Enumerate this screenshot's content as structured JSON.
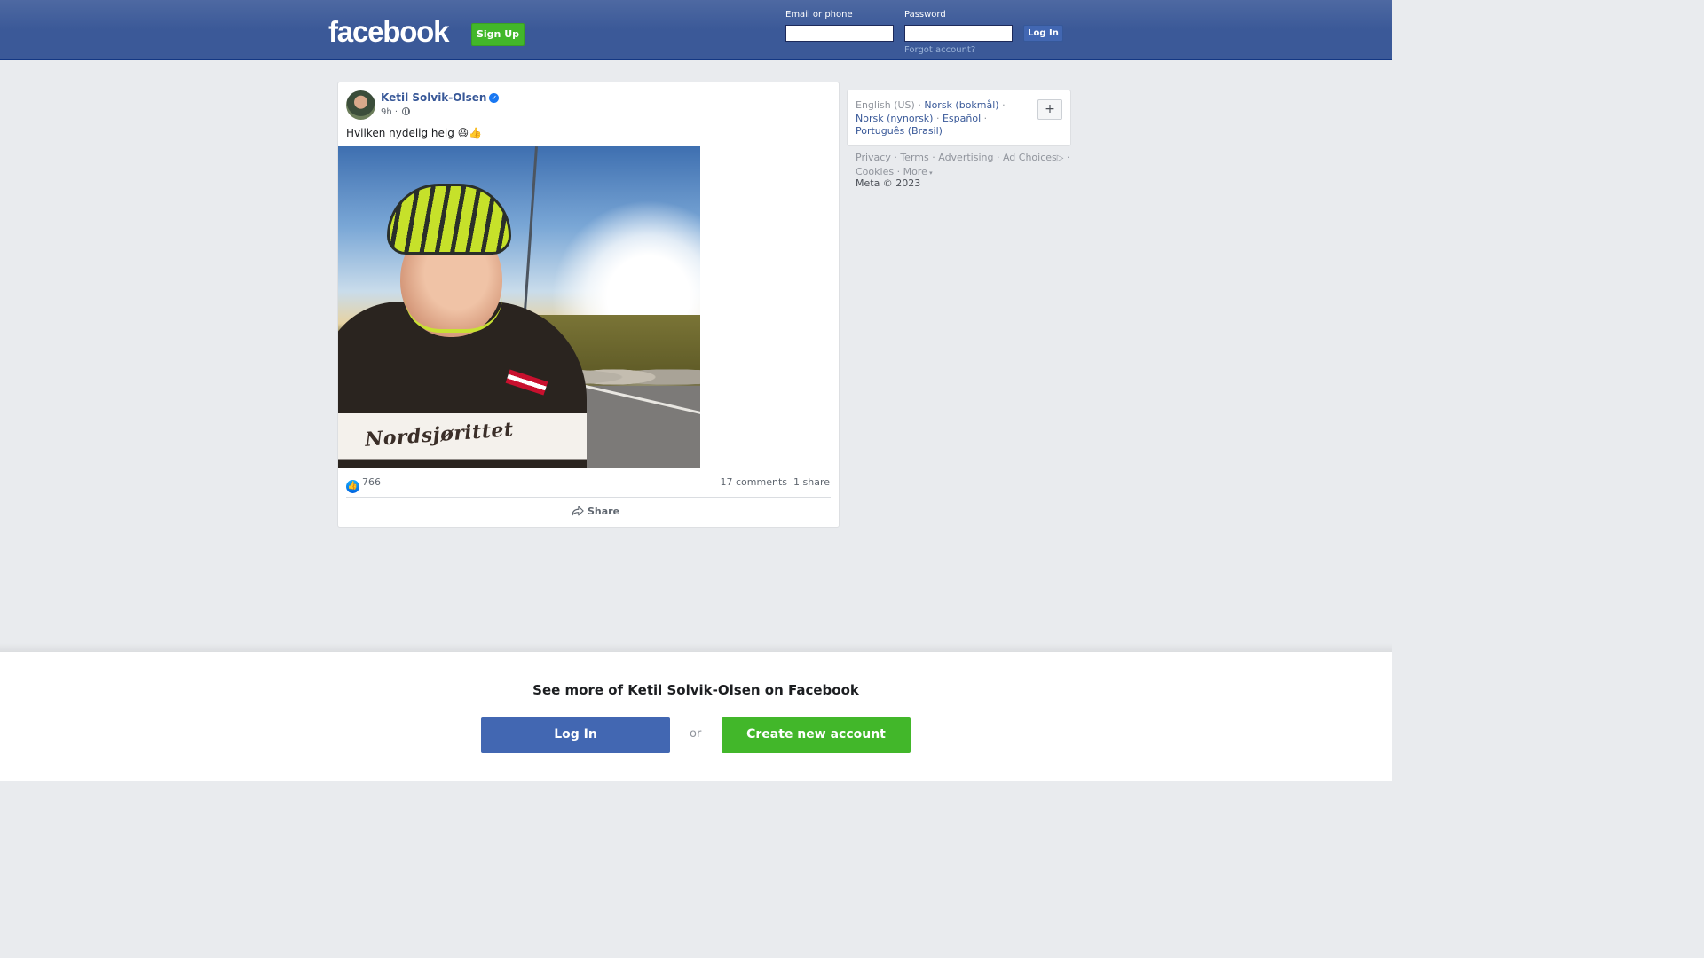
{
  "header": {
    "logo": "facebook",
    "signup_label": "Sign Up",
    "email_label": "Email or phone",
    "password_label": "Password",
    "email_value": "",
    "password_value": "",
    "login_label": "Log In",
    "forgot_label": "Forgot account?"
  },
  "post": {
    "author": "Ketil Solvik-Olsen",
    "verified_icon": "verified-badge-icon",
    "time": "9h",
    "time_separator": "·",
    "privacy_icon": "globe-icon",
    "text": "Hvilken nydelig helg 😃👍",
    "photo_alt": "",
    "photo_jersey_text": "Nordsjørittet",
    "reaction_icon": "like-icon",
    "reaction_count": "766",
    "comments": "17 comments",
    "shares": "1 share",
    "share_label": "Share"
  },
  "languages": {
    "current": "English (US)",
    "items": [
      "Norsk (bokmål)",
      "Norsk (nynorsk)",
      "Español",
      "Português (Brasil)"
    ],
    "more_button": "+"
  },
  "footer": {
    "links": [
      "Privacy",
      "Terms",
      "Advertising",
      "Ad Choices",
      "Cookies",
      "More"
    ],
    "copyright": "Meta © 2023"
  },
  "banner": {
    "title": "See more of Ketil Solvik-Olsen on Facebook",
    "login_label": "Log In",
    "or_label": "or",
    "create_label": "Create new account"
  },
  "colors": {
    "brand_blue": "#3b5998",
    "button_blue": "#4267b2",
    "green": "#42b72a",
    "link": "#385898"
  }
}
